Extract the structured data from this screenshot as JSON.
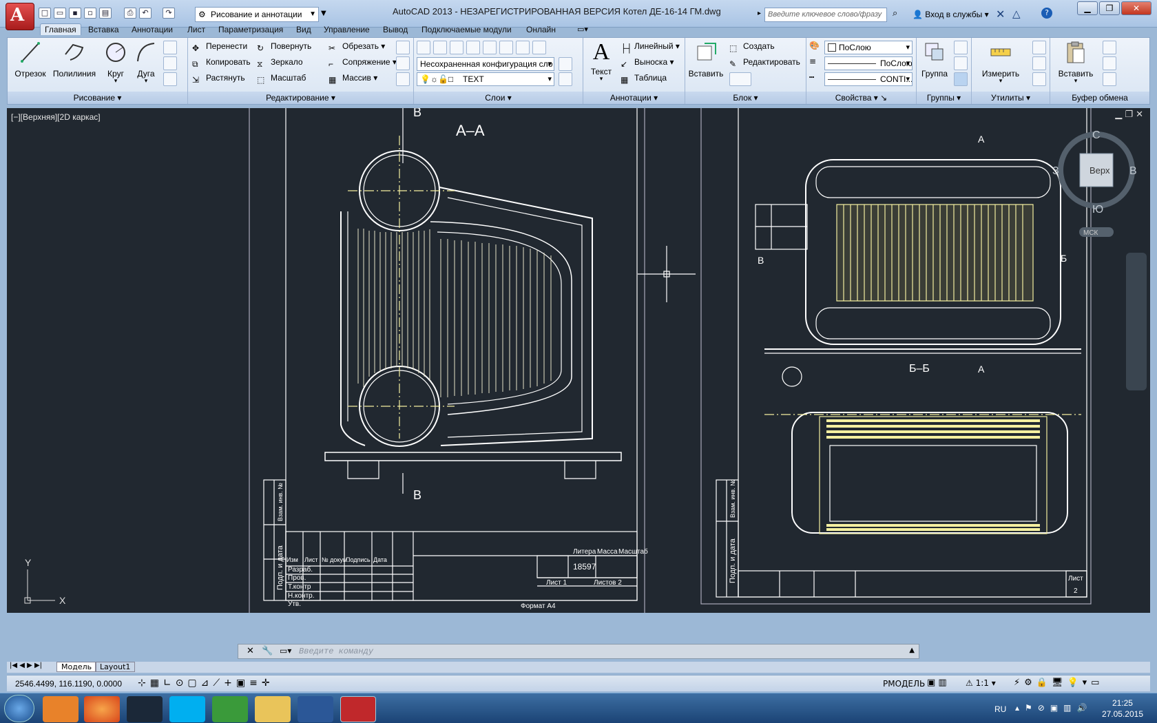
{
  "title_bar": {
    "window_title": "AutoCAD 2013 - НЕЗАРЕГИСТРИРОВАННАЯ ВЕРСИЯ      Котел ДЕ-16-14 ГМ.dwg",
    "workspace": "Рисование и аннотации",
    "search_placeholder": "Введите ключевое слово/фразу",
    "login": "Вход в службы"
  },
  "tabs": [
    "Главная",
    "Вставка",
    "Аннотации",
    "Лист",
    "Параметризация",
    "Вид",
    "Управление",
    "Вывод",
    "Подключаемые модули",
    "Онлайн"
  ],
  "ribbon": {
    "draw": {
      "title": "Рисование",
      "line": "Отрезок",
      "polyline": "Полилиния",
      "circle": "Круг",
      "arc": "Дуга"
    },
    "modify": {
      "title": "Редактирование",
      "move": "Перенести",
      "rotate": "Повернуть",
      "trim": "Обрезать",
      "copy": "Копировать",
      "mirror": "Зеркало",
      "fillet": "Сопряжение",
      "stretch": "Растянуть",
      "scale": "Масштаб",
      "array": "Массив"
    },
    "layers": {
      "title": "Слои",
      "state": "Несохраненная конфигурация сло",
      "current": "TEXT"
    },
    "annotation": {
      "title": "Аннотации",
      "text": "Текст",
      "linear": "Линейный",
      "leader": "Выноска",
      "table": "Таблица"
    },
    "block": {
      "title": "Блок",
      "insert": "Вставить",
      "create": "Создать",
      "edit": "Редактировать"
    },
    "properties": {
      "title": "Свойства",
      "color": "ПоСлою",
      "linetype": "ПоСлою",
      "lineweight": "CONTI..."
    },
    "groups": {
      "title": "Группы",
      "group": "Группа"
    },
    "utilities": {
      "title": "Утилиты",
      "measure": "Измерить"
    },
    "clipboard": {
      "title": "Буфер обмена",
      "paste": "Вставить"
    }
  },
  "viewport": {
    "label": "[−][Верхняя][2D каркас]",
    "viewcube": {
      "n": "С",
      "e": "В",
      "s": "Ю",
      "w": "З",
      "face": "Верх",
      "ucs": "МСК"
    },
    "axis_x": "X",
    "axis_y": "Y"
  },
  "drawing": {
    "section_aa": "А–А",
    "section_bb": "Б–Б",
    "mark_v": "В",
    "mark_b": "Б",
    "mark_a": "А",
    "mass": "18597",
    "sheet": "Лист 1",
    "sheets": "Листов 2",
    "litera": "Литера",
    "massa": "Масса",
    "masshtab": "Масштаб",
    "izm": "Изм",
    "list": "Лист",
    "ndoc": "№ докум.",
    "podpis": "Подпись",
    "data": "Дата",
    "razrab": "Разраб.",
    "prov": "Пров.",
    "tkontr": "Т.контр",
    "nkontr": "Н.контр.",
    "utv": "Утв.",
    "format": "Формат А4",
    "podp_data": "Подп. и дата",
    "inv": "Инв. №",
    "vzam": "Взам. инв. №",
    "list2_label": "Лист",
    "list2_num": "2"
  },
  "command_placeholder": "Введите команду",
  "layout_tabs": [
    "Модель",
    "Layout1"
  ],
  "status": {
    "coords": "2546.4499, 116.1190, 0.0000",
    "model": "РМОДЕЛЬ",
    "scale": "1:1"
  },
  "taskbar": {
    "lang": "RU",
    "time": "21:25",
    "date": "27.05.2015"
  },
  "colors": {
    "bg": "#212830",
    "line": "#ffffff",
    "yellow": "#f5f0a0",
    "ribbon": "#dfe9f5"
  }
}
